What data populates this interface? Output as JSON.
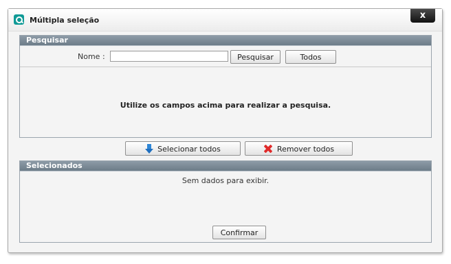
{
  "window": {
    "title": "Múltipla seleção",
    "close_label": "x"
  },
  "search_panel": {
    "header": "Pesquisar",
    "name_label": "Nome :",
    "name_value": "",
    "search_button": "Pesquisar",
    "all_button": "Todos",
    "hint": "Utilize os campos acima para realizar a pesquisa."
  },
  "actions": {
    "select_all": "Selecionar todos",
    "remove_all": "Remover todos"
  },
  "selected_panel": {
    "header": "Selecionados",
    "empty_text": "Sem dados para exibir.",
    "confirm_button": "Confirmar"
  },
  "icons": {
    "app": "app-logo-icon",
    "close": "close-icon",
    "select_all": "arrow-down-icon",
    "remove_all": "red-x-icon"
  },
  "colors": {
    "panel_header": "#7a8894",
    "app_icon": "#0f9a96",
    "arrow": "#2e86d6",
    "remove": "#e02a2a"
  }
}
